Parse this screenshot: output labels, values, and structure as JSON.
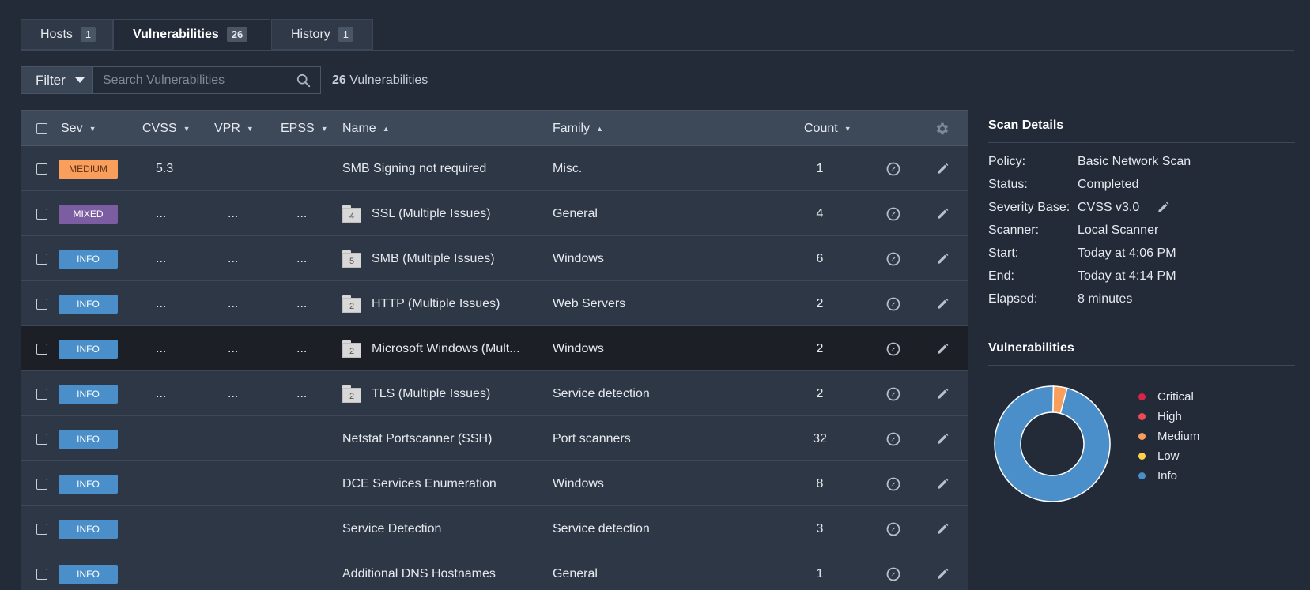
{
  "tabs": [
    {
      "label": "Hosts",
      "count": "1"
    },
    {
      "label": "Vulnerabilities",
      "count": "26"
    },
    {
      "label": "History",
      "count": "1"
    }
  ],
  "filter": {
    "button_label": "Filter",
    "search_placeholder": "Search Vulnerabilities",
    "result_count": "26",
    "result_label": "Vulnerabilities"
  },
  "table": {
    "headers": {
      "sev": "Sev",
      "cvss": "CVSS",
      "vpr": "VPR",
      "epss": "EPSS",
      "name": "Name",
      "family": "Family",
      "count": "Count"
    },
    "rows": [
      {
        "sev": "MEDIUM",
        "sev_color": "#fa9e5c",
        "sev_text": "#5a2c10",
        "cvss": "5.3",
        "vpr": "",
        "epss": "",
        "folder_count": "",
        "name": "SMB Signing not required",
        "family": "Misc.",
        "count": "1"
      },
      {
        "sev": "MIXED",
        "sev_color": "#7c5da2",
        "sev_text": "#ffffff",
        "cvss": "...",
        "vpr": "...",
        "epss": "...",
        "folder_count": "4",
        "name": "SSL (Multiple Issues)",
        "family": "General",
        "count": "4"
      },
      {
        "sev": "INFO",
        "sev_color": "#4a8fca",
        "sev_text": "#ffffff",
        "cvss": "...",
        "vpr": "...",
        "epss": "...",
        "folder_count": "5",
        "name": "SMB (Multiple Issues)",
        "family": "Windows",
        "count": "6"
      },
      {
        "sev": "INFO",
        "sev_color": "#4a8fca",
        "sev_text": "#ffffff",
        "cvss": "...",
        "vpr": "...",
        "epss": "...",
        "folder_count": "2",
        "name": "HTTP (Multiple Issues)",
        "family": "Web Servers",
        "count": "2"
      },
      {
        "sev": "INFO",
        "sev_color": "#4a8fca",
        "sev_text": "#ffffff",
        "cvss": "...",
        "vpr": "...",
        "epss": "...",
        "folder_count": "2",
        "name": "Microsoft Windows (Mult...",
        "family": "Windows",
        "count": "2"
      },
      {
        "sev": "INFO",
        "sev_color": "#4a8fca",
        "sev_text": "#ffffff",
        "cvss": "...",
        "vpr": "...",
        "epss": "...",
        "folder_count": "2",
        "name": "TLS (Multiple Issues)",
        "family": "Service detection",
        "count": "2"
      },
      {
        "sev": "INFO",
        "sev_color": "#4a8fca",
        "sev_text": "#ffffff",
        "cvss": "",
        "vpr": "",
        "epss": "",
        "folder_count": "",
        "name": "Netstat Portscanner (SSH)",
        "family": "Port scanners",
        "count": "32"
      },
      {
        "sev": "INFO",
        "sev_color": "#4a8fca",
        "sev_text": "#ffffff",
        "cvss": "",
        "vpr": "",
        "epss": "",
        "folder_count": "",
        "name": "DCE Services Enumeration",
        "family": "Windows",
        "count": "8"
      },
      {
        "sev": "INFO",
        "sev_color": "#4a8fca",
        "sev_text": "#ffffff",
        "cvss": "",
        "vpr": "",
        "epss": "",
        "folder_count": "",
        "name": "Service Detection",
        "family": "Service detection",
        "count": "3"
      },
      {
        "sev": "INFO",
        "sev_color": "#4a8fca",
        "sev_text": "#ffffff",
        "cvss": "",
        "vpr": "",
        "epss": "",
        "folder_count": "",
        "name": "Additional DNS Hostnames",
        "family": "General",
        "count": "1"
      }
    ]
  },
  "scan_details": {
    "title": "Scan Details",
    "items": [
      {
        "key": "Policy:",
        "value": "Basic Network Scan"
      },
      {
        "key": "Status:",
        "value": "Completed"
      },
      {
        "key": "Severity Base:",
        "value": "CVSS v3.0"
      },
      {
        "key": "Scanner:",
        "value": "Local Scanner"
      },
      {
        "key": "Start:",
        "value": "Today at 4:06 PM"
      },
      {
        "key": "End:",
        "value": "Today at 4:14 PM"
      },
      {
        "key": "Elapsed:",
        "value": "8 minutes"
      }
    ]
  },
  "vulnerabilities_panel": {
    "title": "Vulnerabilities",
    "legend": [
      {
        "label": "Critical",
        "color": "#d9234a"
      },
      {
        "label": "High",
        "color": "#ee4a55"
      },
      {
        "label": "Medium",
        "color": "#fa9e5c"
      },
      {
        "label": "Low",
        "color": "#fcd34b"
      },
      {
        "label": "Info",
        "color": "#4a8fca"
      }
    ]
  },
  "chart_data": {
    "type": "pie",
    "categories": [
      "Critical",
      "High",
      "Medium",
      "Low",
      "Info"
    ],
    "values": [
      0,
      0,
      1,
      0,
      25
    ],
    "title": "Vulnerabilities"
  },
  "icons": {
    "search": "search-icon",
    "settings": "gear-icon",
    "live_results": "clock-check-icon",
    "edit": "pencil-icon",
    "folder": "folder-icon"
  }
}
